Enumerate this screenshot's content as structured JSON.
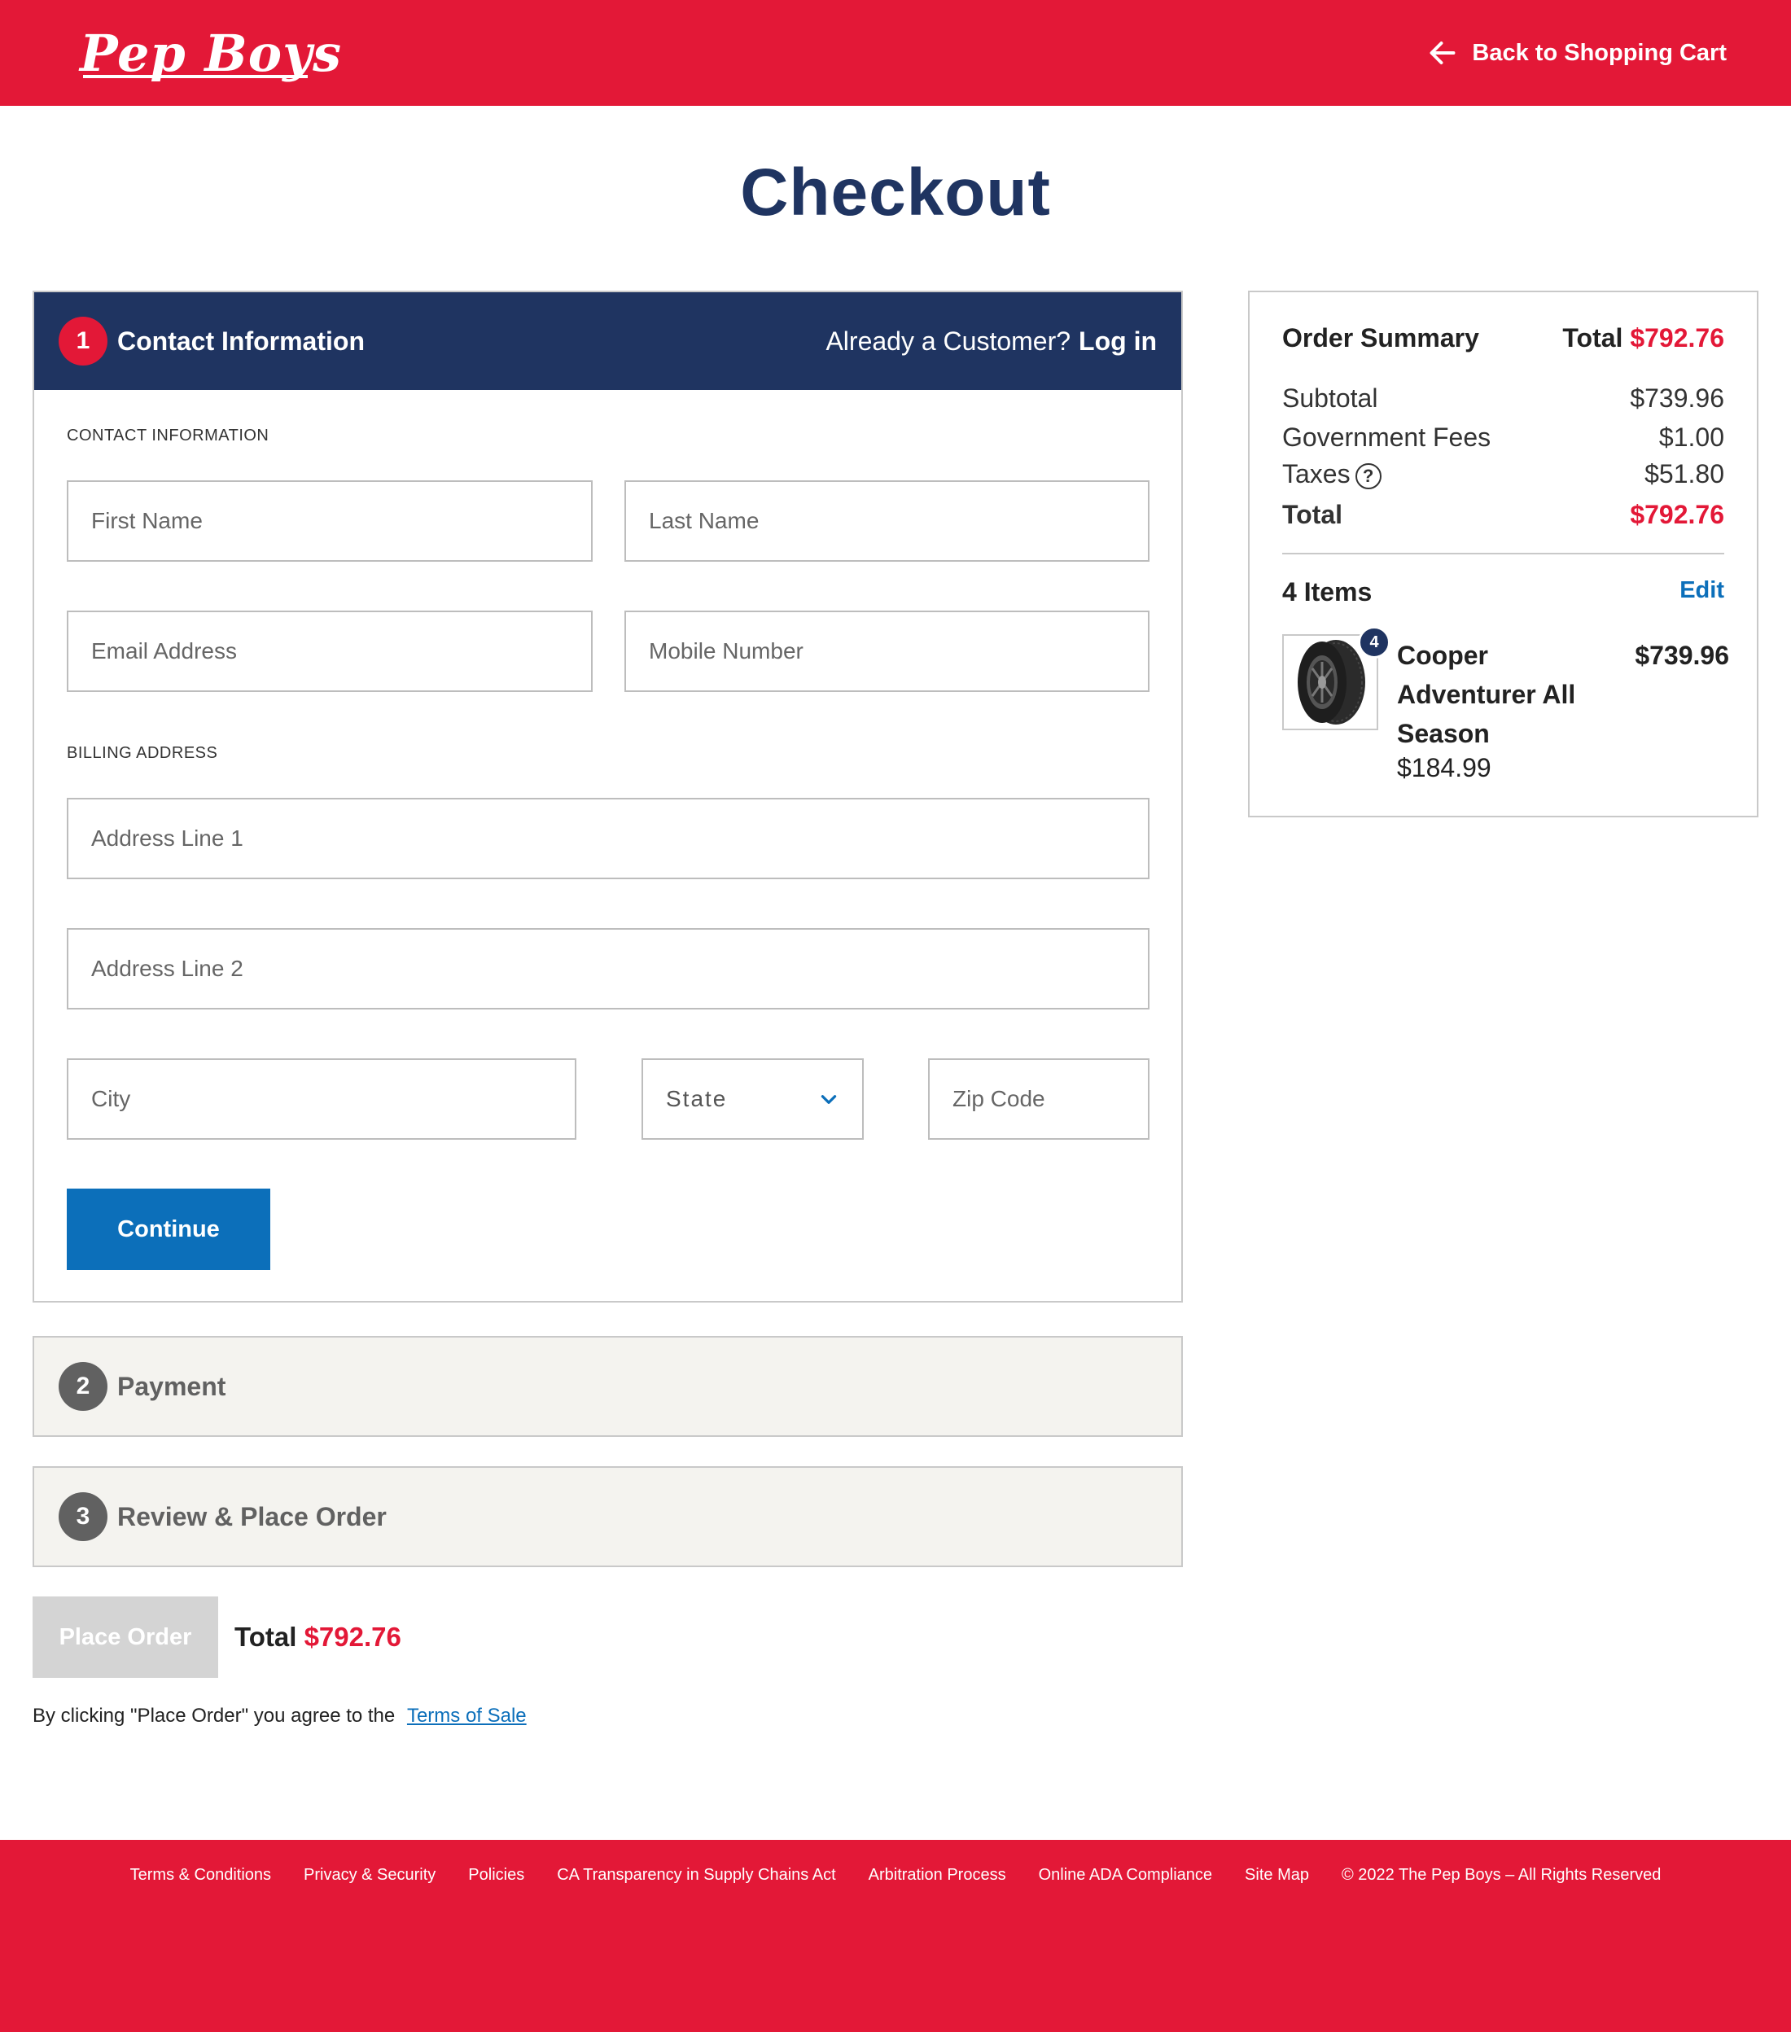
{
  "header": {
    "logo_text": "Pep Boys",
    "back_link": "Back to Shopping Cart"
  },
  "page_title": "Checkout",
  "contact": {
    "step": "1",
    "title": "Contact Information",
    "already_text": "Already a Customer?",
    "login_label": "Log in",
    "section_contact": "CONTACT INFORMATION",
    "section_billing": "BILLING ADDRESS",
    "placeholders": {
      "first_name": "First Name",
      "last_name": "Last Name",
      "email": "Email Address",
      "mobile": "Mobile Number",
      "address1": "Address Line 1",
      "address2": "Address Line 2",
      "city": "City",
      "state": "State",
      "zip": "Zip Code"
    },
    "continue_label": "Continue"
  },
  "payment": {
    "step": "2",
    "title": "Payment"
  },
  "review": {
    "step": "3",
    "title": "Review & Place Order"
  },
  "place_order": {
    "button_label": "Place Order",
    "total_label": "Total",
    "total_value": "$792.76",
    "agree_text": "By clicking \"Place Order\" you agree to the",
    "terms_link": "Terms of Sale"
  },
  "summary": {
    "title": "Order Summary",
    "total_label": "Total",
    "total_value": "$792.76",
    "rows": {
      "subtotal_label": "Subtotal",
      "subtotal_value": "$739.96",
      "fees_label": "Government Fees",
      "fees_value": "$1.00",
      "taxes_label": "Taxes",
      "taxes_value": "$51.80",
      "total_label": "Total",
      "total_value": "$792.76"
    },
    "items_count": "4 Items",
    "edit_label": "Edit",
    "item": {
      "qty": "4",
      "name": "Cooper Adventurer All Season",
      "unit_price": "$184.99",
      "line_total": "$739.96"
    }
  },
  "footer": {
    "links": [
      "Terms & Conditions",
      "Privacy & Security",
      "Policies",
      "CA Transparency in Supply Chains Act",
      "Arbitration Process",
      "Online ADA Compliance",
      "Site Map"
    ],
    "copyright": "© 2022 The Pep Boys – All Rights Reserved"
  },
  "colors": {
    "brand_red": "#e31837",
    "navy": "#1f3461",
    "link_blue": "#0c6fba"
  }
}
